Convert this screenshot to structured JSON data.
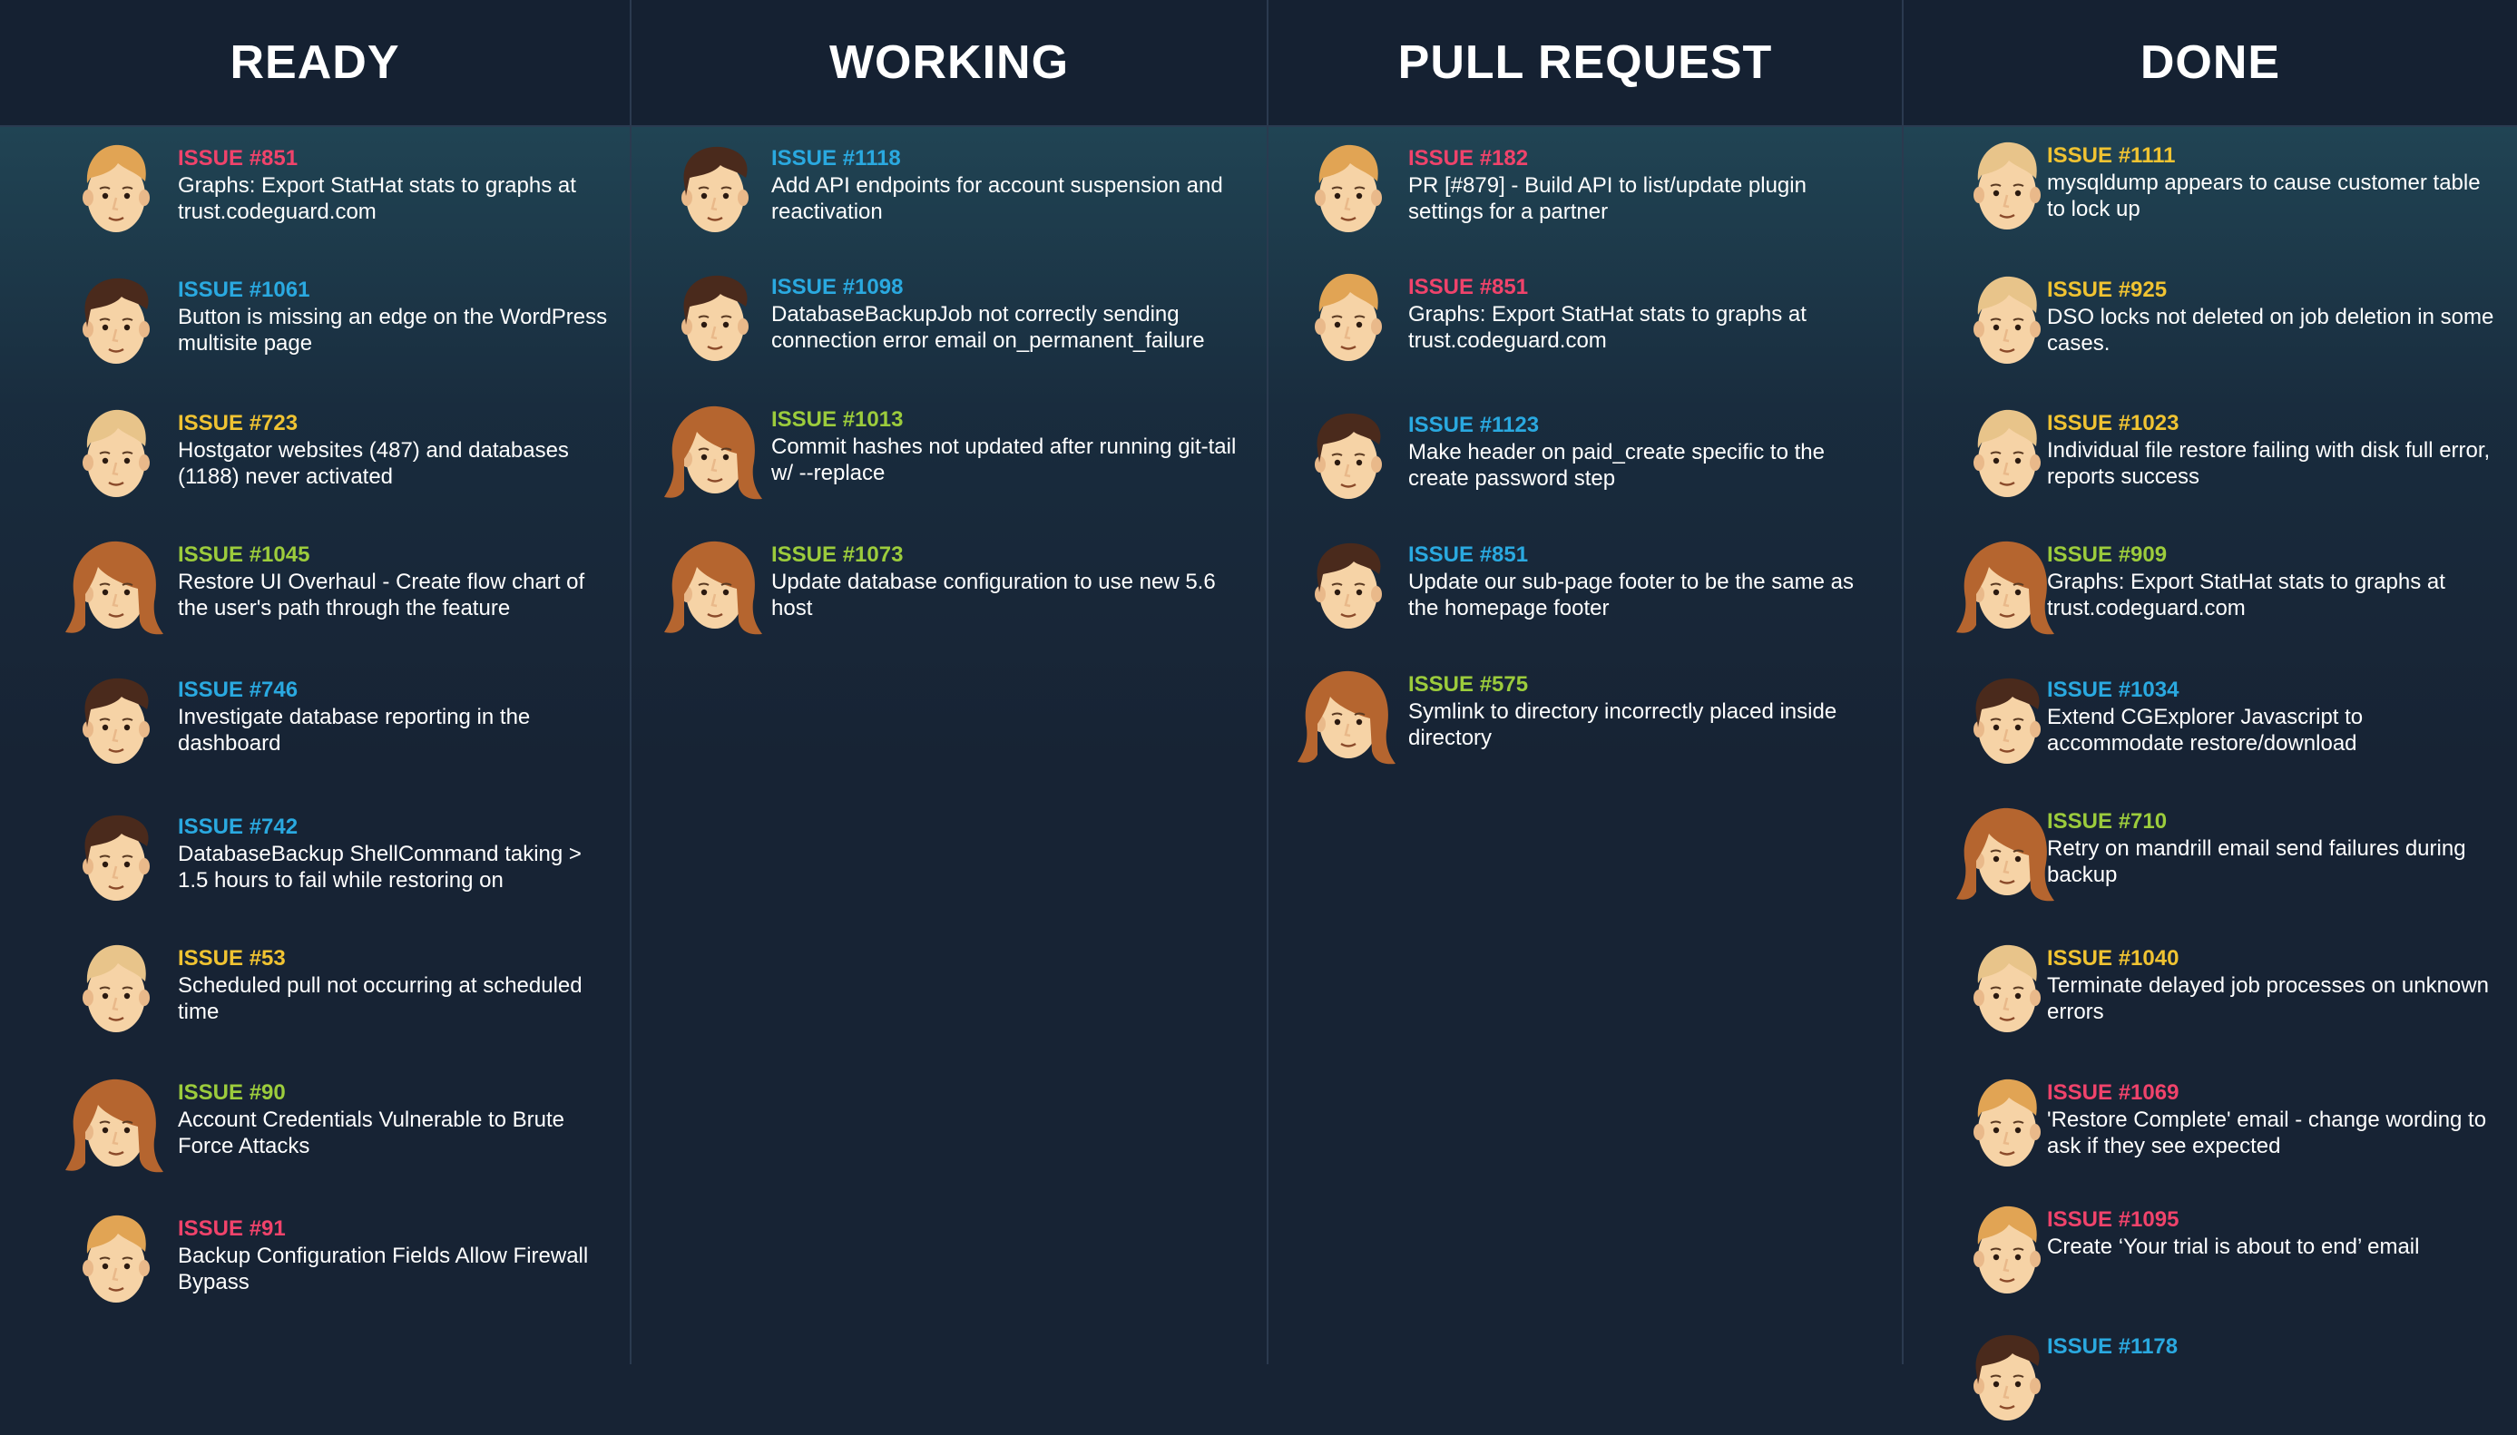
{
  "colors": {
    "red": "#f0436b",
    "blue": "#2aa9e0",
    "yellow": "#f0c332",
    "green": "#9ccc3c"
  },
  "columns": [
    {
      "title": "READY",
      "cards": [
        {
          "issue": "ISSUE #851",
          "color": "red",
          "avatar": "blond-man-avatar",
          "desc": "Graphs: Export StatHat stats to graphs at trust.codeguard.com"
        },
        {
          "issue": "ISSUE #1061",
          "color": "blue",
          "avatar": "dark-hair-man-avatar",
          "desc": "Button is missing an edge on the WordPress multisite page"
        },
        {
          "issue": "ISSUE #723",
          "color": "yellow",
          "avatar": "light-hair-man-avatar",
          "desc": "Hostgator websites (487) and databases (1188) never activated"
        },
        {
          "issue": "ISSUE #1045",
          "color": "green",
          "avatar": "woman-avatar",
          "desc": "Restore UI Overhaul - Create flow chart of the user's path through the feature"
        },
        {
          "issue": "ISSUE #746",
          "color": "blue",
          "avatar": "dark-hair-man-avatar",
          "desc": "Investigate database reporting in the dashboard"
        },
        {
          "issue": "ISSUE #742",
          "color": "blue",
          "avatar": "dark-hair-man-avatar",
          "desc": "DatabaseBackup ShellCommand taking > 1.5 hours to fail while restoring on"
        },
        {
          "issue": "ISSUE #53",
          "color": "yellow",
          "avatar": "light-hair-man-avatar",
          "desc": "Scheduled pull not occurring at scheduled time"
        },
        {
          "issue": "ISSUE #90",
          "color": "green",
          "avatar": "woman-avatar",
          "desc": "Account Credentials Vulnerable to Brute Force Attacks"
        },
        {
          "issue": "ISSUE #91",
          "color": "red",
          "avatar": "blond-man-avatar",
          "desc": "Backup Configuration Fields Allow Firewall Bypass"
        }
      ]
    },
    {
      "title": "WORKING",
      "cards": [
        {
          "issue": "ISSUE #1118",
          "color": "blue",
          "avatar": "dark-hair-man-avatar",
          "desc": "Add API endpoints for account suspension and reactivation"
        },
        {
          "issue": "ISSUE #1098",
          "color": "blue",
          "avatar": "dark-hair-man-avatar",
          "desc": "DatabaseBackupJob not correctly sending connection error email on_permanent_failure"
        },
        {
          "issue": "ISSUE #1013",
          "color": "green",
          "avatar": "woman-avatar",
          "desc": "Commit hashes not updated after running git-tail w/ --replace"
        },
        {
          "issue": "ISSUE #1073",
          "color": "green",
          "avatar": "woman-avatar",
          "desc": "Update database configuration to use new 5.6 host"
        }
      ]
    },
    {
      "title": "PULL REQUEST",
      "cards": [
        {
          "issue": "ISSUE #182",
          "color": "red",
          "avatar": "blond-man-avatar",
          "desc": "PR [#879] - Build API to list/update plugin settings for a partner"
        },
        {
          "issue": "ISSUE #851",
          "color": "red",
          "avatar": "blond-man-avatar",
          "desc": "Graphs: Export StatHat stats to graphs at trust.codeguard.com"
        },
        {
          "issue": "ISSUE #1123",
          "color": "blue",
          "avatar": "dark-hair-man-avatar",
          "desc": "Make header on paid_create specific to the create password step"
        },
        {
          "issue": "ISSUE #851",
          "color": "blue",
          "avatar": "dark-hair-man-avatar",
          "desc": "Update our sub-page footer to be the same as the homepage footer"
        },
        {
          "issue": "ISSUE #575",
          "color": "green",
          "avatar": "woman-avatar",
          "desc": "Symlink to directory incorrectly placed inside directory"
        }
      ]
    },
    {
      "title": "DONE",
      "cards": [
        {
          "issue": "ISSUE #1111",
          "color": "yellow",
          "avatar": "light-hair-man-avatar",
          "desc": "mysqldump appears to cause customer table to lock up"
        },
        {
          "issue": "ISSUE #925",
          "color": "yellow",
          "avatar": "light-hair-man-avatar",
          "desc": "DSO locks not deleted on job deletion in some cases."
        },
        {
          "issue": "ISSUE #1023",
          "color": "yellow",
          "avatar": "light-hair-man-avatar",
          "desc": "Individual file restore failing with disk full error, reports success"
        },
        {
          "issue": "ISSUE #909",
          "color": "green",
          "avatar": "woman-avatar",
          "desc": "Graphs: Export StatHat stats to graphs at trust.codeguard.com"
        },
        {
          "issue": "ISSUE #1034",
          "color": "blue",
          "avatar": "dark-hair-man-avatar",
          "desc": "Extend CGExplorer Javascript to accommodate restore/download"
        },
        {
          "issue": "ISSUE #710",
          "color": "green",
          "avatar": "woman-avatar",
          "desc": "Retry on mandrill email send failures during backup"
        },
        {
          "issue": "ISSUE #1040",
          "color": "yellow",
          "avatar": "light-hair-man-avatar",
          "desc": "Terminate delayed job processes on unknown errors"
        },
        {
          "issue": "ISSUE #1069",
          "color": "red",
          "avatar": "blond-man-avatar",
          "desc": "'Restore Complete' email - change wording to ask if they see expected"
        },
        {
          "issue": "ISSUE #1095",
          "color": "red",
          "avatar": "blond-man-avatar",
          "desc": "Create ‘Your trial is about to end’ email"
        },
        {
          "issue": "ISSUE #1178",
          "color": "blue",
          "avatar": "dark-hair-man-avatar",
          "desc": ""
        }
      ]
    }
  ]
}
